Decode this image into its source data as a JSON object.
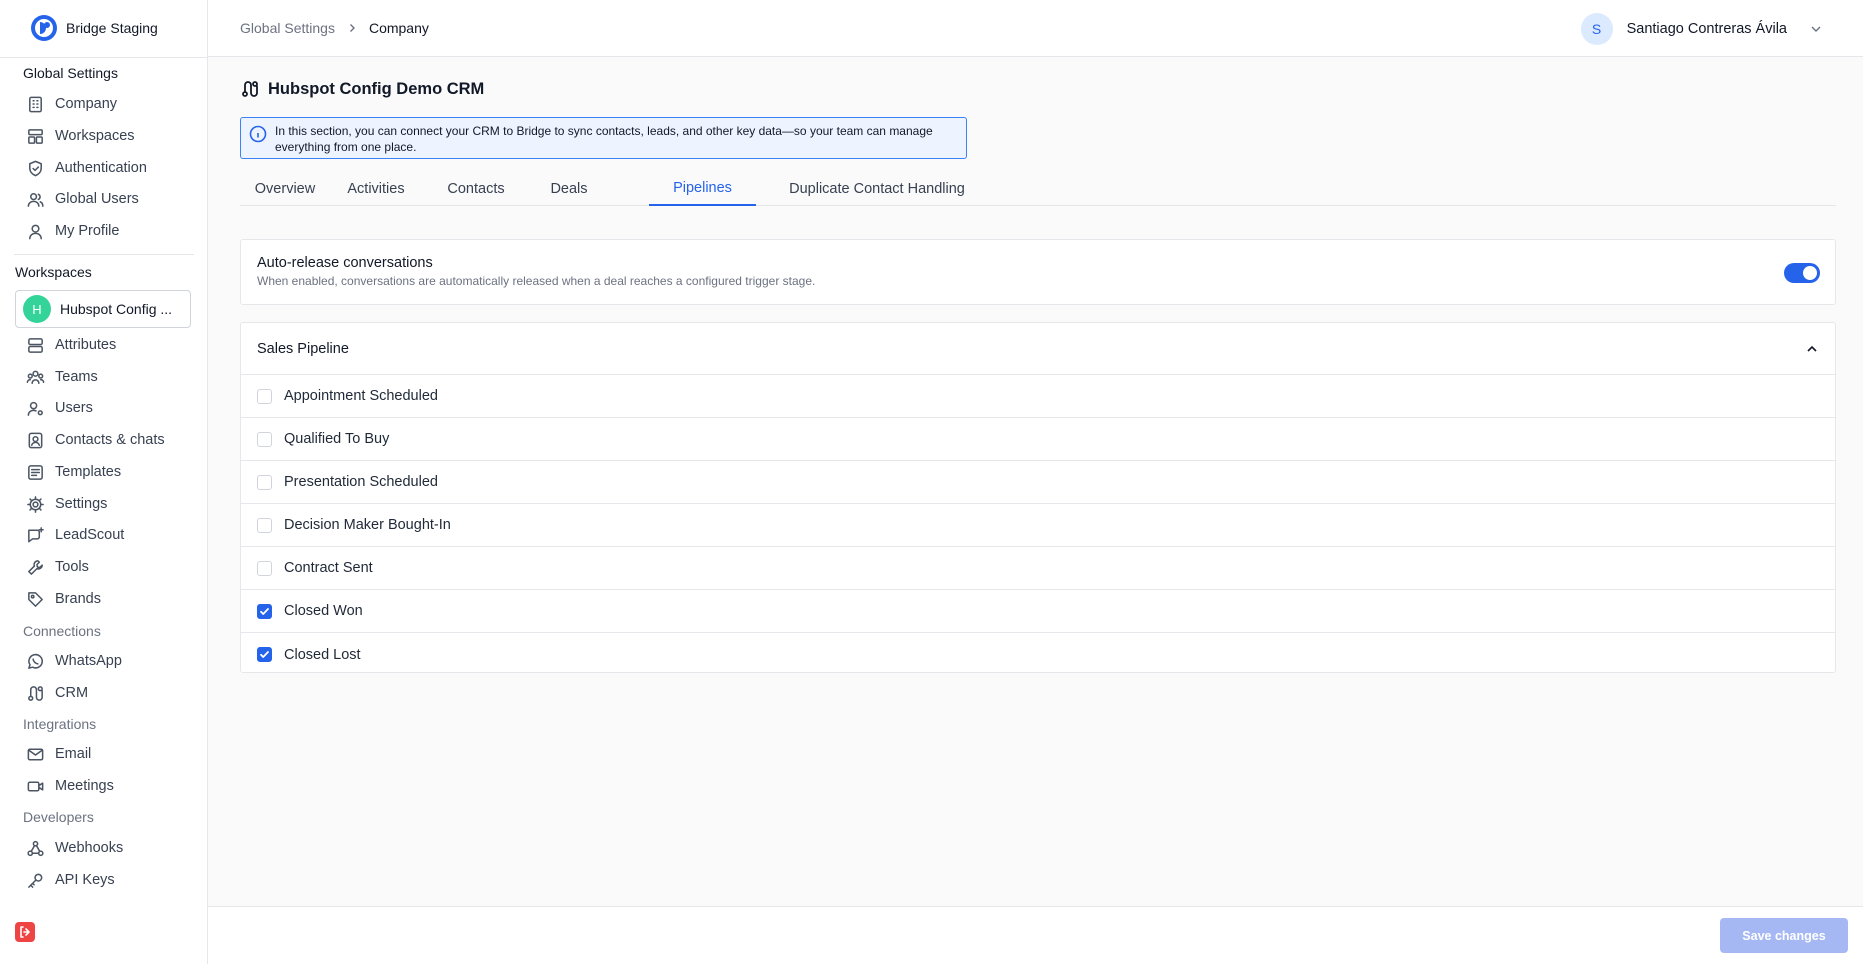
{
  "app": {
    "name": "Bridge Staging"
  },
  "sidebar": {
    "global_section": "Global Settings",
    "global_items": [
      {
        "label": "Company",
        "icon": "building-icon"
      },
      {
        "label": "Workspaces",
        "icon": "layout-icon"
      },
      {
        "label": "Authentication",
        "icon": "shield-icon"
      },
      {
        "label": "Global Users",
        "icon": "users-icon"
      },
      {
        "label": "My Profile",
        "icon": "user-icon"
      }
    ],
    "workspaces_section": "Workspaces",
    "workspace": {
      "initial": "H",
      "name": "Hubspot Config ..."
    },
    "workspace_items": [
      {
        "label": "Attributes",
        "icon": "attributes-icon"
      },
      {
        "label": "Teams",
        "icon": "teams-icon"
      },
      {
        "label": "Users",
        "icon": "user-gear-icon"
      },
      {
        "label": "Contacts & chats",
        "icon": "contact-icon"
      },
      {
        "label": "Templates",
        "icon": "template-icon"
      },
      {
        "label": "Settings",
        "icon": "gear-icon"
      },
      {
        "label": "LeadScout",
        "icon": "leadscout-icon"
      },
      {
        "label": "Tools",
        "icon": "wrench-icon"
      },
      {
        "label": "Brands",
        "icon": "tag-icon"
      }
    ],
    "connections_section": "Connections",
    "connections_items": [
      {
        "label": "WhatsApp",
        "icon": "whatsapp-icon"
      },
      {
        "label": "CRM",
        "icon": "crm-icon"
      }
    ],
    "integrations_section": "Integrations",
    "integrations_items": [
      {
        "label": "Email",
        "icon": "mail-icon"
      },
      {
        "label": "Meetings",
        "icon": "video-icon"
      }
    ],
    "developers_section": "Developers",
    "developers_items": [
      {
        "label": "Webhooks",
        "icon": "webhook-icon"
      },
      {
        "label": "API Keys",
        "icon": "key-icon"
      }
    ]
  },
  "header": {
    "breadcrumb": [
      "Global Settings",
      "Company"
    ],
    "user": {
      "initial": "S",
      "name": "Santiago Contreras Ávila"
    }
  },
  "main": {
    "title": "Hubspot Config Demo CRM",
    "info": "In this section, you can connect your CRM to Bridge to sync contacts, leads, and other key data—so your team can manage everything from one place.",
    "tabs": [
      "Overview",
      "Activities",
      "Contacts",
      "Deals",
      "Pipelines",
      "Duplicate Contact Handling"
    ],
    "active_tab": "Pipelines",
    "auto_release": {
      "title": "Auto-release conversations",
      "description": "When enabled, conversations are automatically released when a deal reaches a configured trigger stage.",
      "enabled": true
    },
    "pipeline": {
      "title": "Sales Pipeline",
      "stages": [
        {
          "label": "Appointment Scheduled",
          "checked": false
        },
        {
          "label": "Qualified To Buy",
          "checked": false
        },
        {
          "label": "Presentation Scheduled",
          "checked": false
        },
        {
          "label": "Decision Maker Bought-In",
          "checked": false
        },
        {
          "label": "Contract Sent",
          "checked": false
        },
        {
          "label": "Closed Won",
          "checked": true
        },
        {
          "label": "Closed Lost",
          "checked": true
        }
      ]
    }
  },
  "footer": {
    "save_label": "Save changes"
  },
  "colors": {
    "accent": "#2563eb",
    "workspace_avatar": "#34d399",
    "save_disabled": "#a5b8f3"
  }
}
